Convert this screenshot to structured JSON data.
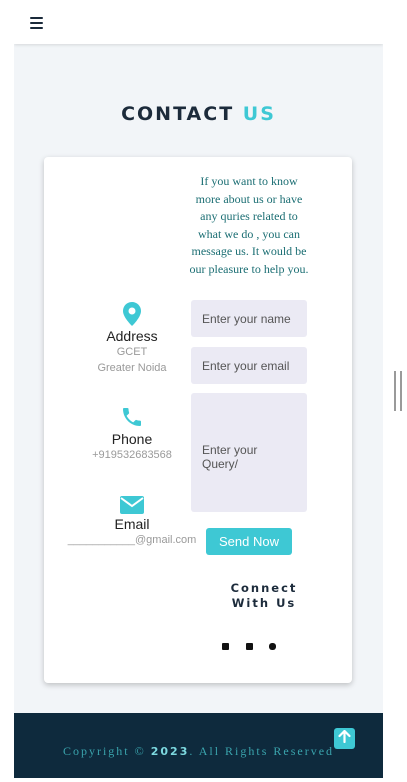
{
  "nav": {
    "menu_icon": "hamburger-icon"
  },
  "heading": {
    "part1": "CONTACT",
    "part2": "US"
  },
  "intro": "If you want to know more about us or have any quries related to what we do , you can message us. It would be our pleasure to help you.",
  "info": {
    "address": {
      "icon": "map-pin-icon",
      "label": "Address",
      "line1": "GCET",
      "line2": "Greater Noida"
    },
    "phone": {
      "icon": "phone-icon",
      "label": "Phone",
      "value": "+919532683568"
    },
    "email": {
      "icon": "envelope-icon",
      "label": "Email",
      "value": "___________@gmail.com"
    }
  },
  "form": {
    "name_placeholder": "Enter your name",
    "email_placeholder": "Enter your email",
    "query_placeholder": "Enter your Query/",
    "send_label": "Send Now"
  },
  "connect": {
    "line1": "Connect",
    "line2": "With Us",
    "icons": [
      "linkedin-icon",
      "youtube-icon",
      "instagram-icon"
    ]
  },
  "footer": {
    "prefix": "Copyright © ",
    "year": "2023",
    "suffix": ". All Rights Reserved",
    "top_icon": "arrow-up-icon"
  },
  "colors": {
    "accent": "#3ec8d4",
    "navy": "#0e2a3d",
    "text_dark": "#1c2b3b"
  }
}
